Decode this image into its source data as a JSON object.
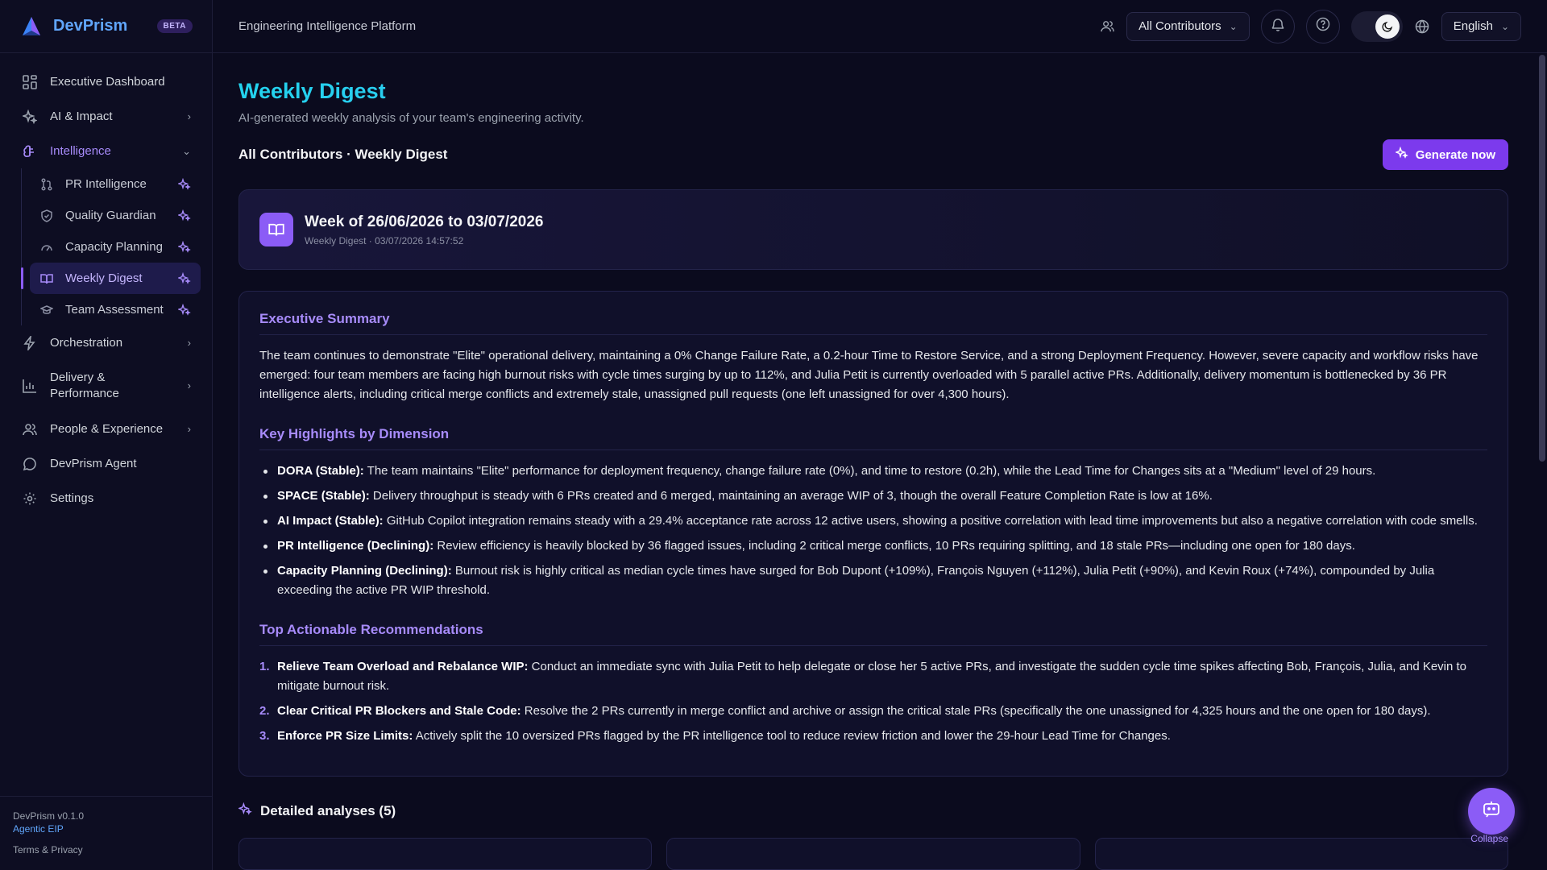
{
  "brand": {
    "name": "DevPrism",
    "badge": "BETA"
  },
  "nav": {
    "executive": "Executive Dashboard",
    "ai_impact": "AI & Impact",
    "intelligence": "Intelligence",
    "sub": [
      "PR Intelligence",
      "Quality Guardian",
      "Capacity Planning",
      "Weekly Digest",
      "Team Assessment"
    ],
    "orchestration": "Orchestration",
    "delivery": "Delivery &",
    "delivery2": "Performance",
    "people": "People & Experience",
    "agent": "DevPrism Agent",
    "settings": "Settings"
  },
  "footer": {
    "version": "DevPrism v0.1.0",
    "tagline": "Agentic EIP",
    "terms": "Terms & Privacy"
  },
  "topbar": {
    "platform": "Engineering Intelligence Platform",
    "contributors": "All Contributors",
    "language": "English"
  },
  "page": {
    "title": "Weekly Digest",
    "subtitle": "AI-generated weekly analysis of your team's engineering activity.",
    "section_heading": "All Contributors · Weekly Digest",
    "generate": "Generate now"
  },
  "week": {
    "title": "Week of 26/06/2026 to 03/07/2026",
    "meta": "Weekly Digest · 03/07/2026 14:57:52"
  },
  "digest": {
    "exec_title": "Executive Summary",
    "exec_text": "The team continues to demonstrate \"Elite\" operational delivery, maintaining a 0% Change Failure Rate, a 0.2-hour Time to Restore Service, and a strong Deployment Frequency. However, severe capacity and workflow risks have emerged: four team members are facing high burnout risks with cycle times surging by up to 112%, and Julia Petit is currently overloaded with 5 parallel active PRs. Additionally, delivery momentum is bottlenecked by 36 PR intelligence alerts, including critical merge conflicts and extremely stale, unassigned pull requests (one left unassigned for over 4,300 hours).",
    "hl_title": "Key Highlights by Dimension",
    "highlights": [
      {
        "k": "DORA (Stable):",
        "v": " The team maintains \"Elite\" performance for deployment frequency, change failure rate (0%), and time to restore (0.2h), while the Lead Time for Changes sits at a \"Medium\" level of 29 hours."
      },
      {
        "k": "SPACE (Stable):",
        "v": " Delivery throughput is steady with 6 PRs created and 6 merged, maintaining an average WIP of 3, though the overall Feature Completion Rate is low at 16%."
      },
      {
        "k": "AI Impact (Stable):",
        "v": " GitHub Copilot integration remains steady with a 29.4% acceptance rate across 12 active users, showing a positive correlation with lead time improvements but also a negative correlation with code smells."
      },
      {
        "k": "PR Intelligence (Declining):",
        "v": " Review efficiency is heavily blocked by 36 flagged issues, including 2 critical merge conflicts, 10 PRs requiring splitting, and 18 stale PRs—including one open for 180 days."
      },
      {
        "k": "Capacity Planning (Declining):",
        "v": " Burnout risk is highly critical as median cycle times have surged for Bob Dupont (+109%), François Nguyen (+112%), Julia Petit (+90%), and Kevin Roux (+74%), compounded by Julia exceeding the active PR WIP threshold."
      }
    ],
    "rec_title": "Top Actionable Recommendations",
    "recs": [
      {
        "n": "1.",
        "k": "Relieve Team Overload and Rebalance WIP:",
        "v": " Conduct an immediate sync with Julia Petit to help delegate or close her 5 active PRs, and investigate the sudden cycle time spikes affecting Bob, François, Julia, and Kevin to mitigate burnout risk."
      },
      {
        "n": "2.",
        "k": "Clear Critical PR Blockers and Stale Code:",
        "v": " Resolve the 2 PRs currently in merge conflict and archive or assign the critical stale PRs (specifically the one unassigned for 4,325 hours and the one open for 180 days)."
      },
      {
        "n": "3.",
        "k": "Enforce PR Size Limits:",
        "v": " Actively split the 10 oversized PRs flagged by the PR intelligence tool to reduce review friction and lower the 29-hour Lead Time for Changes."
      }
    ]
  },
  "detailed": "Detailed analyses (5)",
  "collapse": "Collapse"
}
